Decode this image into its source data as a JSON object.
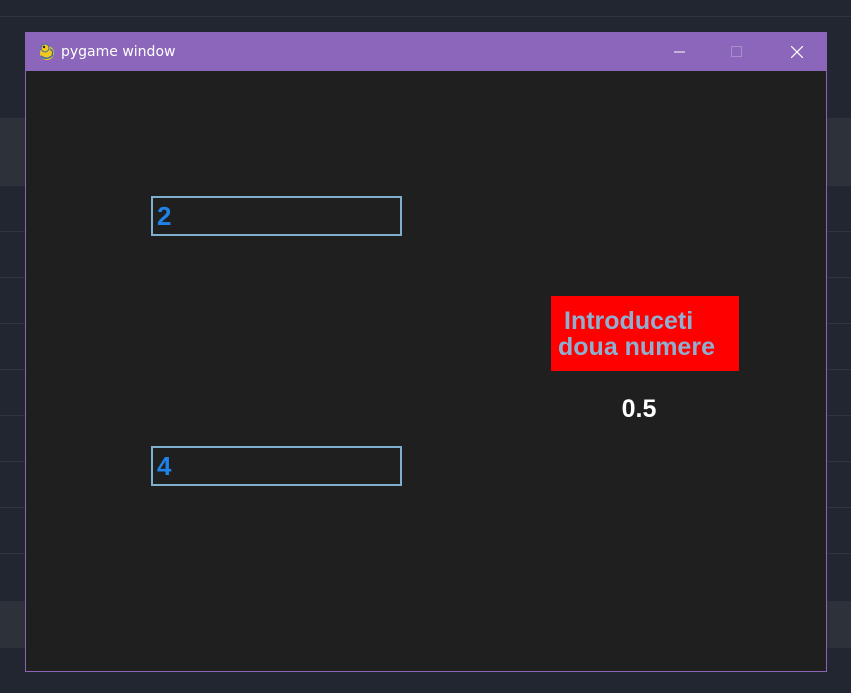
{
  "window": {
    "title": "pygame window",
    "icon": "pygame-snake-icon",
    "controls": {
      "minimize": "minimize-icon",
      "maximize": "maximize-icon",
      "close": "close-icon"
    }
  },
  "inputs": {
    "first_value": "2",
    "second_value": "4"
  },
  "prompt": {
    "line1": "Introduceti",
    "line2": "doua numere"
  },
  "result": {
    "value": "0.5"
  },
  "colors": {
    "titlebar": "#8c66ba",
    "window_bg": "#1f1f1f",
    "input_border": "#7fafcf",
    "input_text": "#1e82e6",
    "prompt_bg": "#ff0000",
    "prompt_text": "#8fafd0",
    "result_text": "#ffffff"
  }
}
